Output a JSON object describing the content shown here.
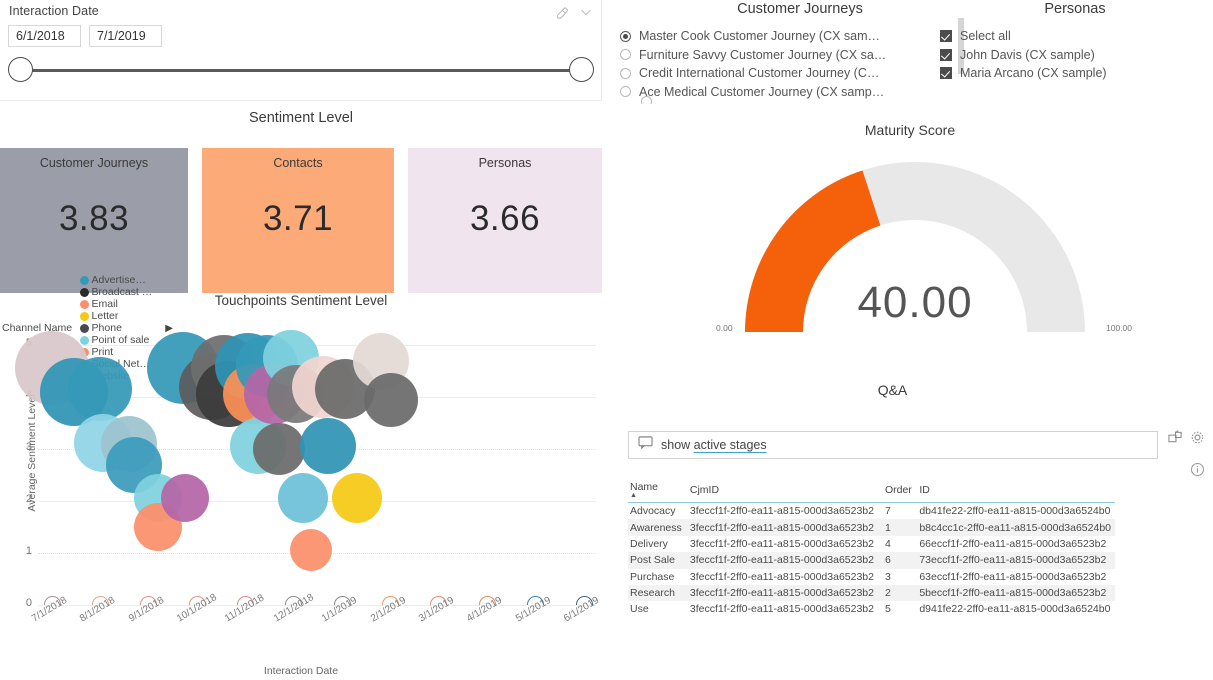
{
  "slicer": {
    "title": "Interaction Date",
    "start_date": "6/1/2018",
    "end_date": "7/1/2019",
    "eraser_icon": "eraser-icon",
    "chevron_icon": "chevron-down-icon"
  },
  "sentiment": {
    "title": "Sentiment  Level",
    "cards": [
      {
        "label": "Customer Journeys",
        "value": "3.83",
        "color": "#9b9da8"
      },
      {
        "label": "Contacts",
        "value": "3.71",
        "color": "#fcab78"
      },
      {
        "label": "Personas",
        "value": "3.66",
        "color": "#f0e4ef"
      }
    ]
  },
  "customer_journeys": {
    "title": "Customer Journeys",
    "items": [
      {
        "label": "Master Cook Customer Journey (CX sam…",
        "selected": true
      },
      {
        "label": "Furniture Savvy Customer Journey (CX sa…",
        "selected": false
      },
      {
        "label": "Credit International Customer Journey (C…",
        "selected": false
      },
      {
        "label": "Ace Medical Customer Journey (CX samp…",
        "selected": false
      }
    ]
  },
  "personas": {
    "title": "Personas",
    "items": [
      {
        "label": "Select all",
        "checked": true
      },
      {
        "label": "John Davis (CX sample)",
        "checked": true
      },
      {
        "label": "Maria Arcano (CX sample)",
        "checked": true
      }
    ]
  },
  "gauge": {
    "title": "Maturity Score",
    "value": "40.00",
    "min_label": "0.00",
    "max_label": "100.00",
    "fill_color": "#f4610a",
    "track_color": "#e8e8e8",
    "percent": 40
  },
  "qa": {
    "title": "Q&A",
    "prefix": "show ",
    "query_highlight": "active stages",
    "chat_icon": "chat-bubble-icon",
    "popout_icon": "pop-out-icon",
    "gear_icon": "gear-icon",
    "info_icon": "info-icon"
  },
  "table": {
    "columns": [
      "Name",
      "CjmID",
      "Order",
      "ID"
    ],
    "sorted_column": "Name",
    "rows": [
      [
        "Advocacy",
        "3feccf1f-2ff0-ea11-a815-000d3a6523b2",
        "7",
        "db41fe22-2ff0-ea11-a815-000d3a6524b0"
      ],
      [
        "Awareness",
        "3feccf1f-2ff0-ea11-a815-000d3a6523b2",
        "1",
        "b8c4cc1c-2ff0-ea11-a815-000d3a6524b0"
      ],
      [
        "Delivery",
        "3feccf1f-2ff0-ea11-a815-000d3a6523b2",
        "4",
        "66eccf1f-2ff0-ea11-a815-000d3a6523b2"
      ],
      [
        "Post Sale",
        "3feccf1f-2ff0-ea11-a815-000d3a6523b2",
        "6",
        "73eccf1f-2ff0-ea11-a815-000d3a6523b2"
      ],
      [
        "Purchase",
        "3feccf1f-2ff0-ea11-a815-000d3a6523b2",
        "3",
        "63eccf1f-2ff0-ea11-a815-000d3a6523b2"
      ],
      [
        "Research",
        "3feccf1f-2ff0-ea11-a815-000d3a6523b2",
        "2",
        "5beccf1f-2ff0-ea11-a815-000d3a6523b2"
      ],
      [
        "Use",
        "3feccf1f-2ff0-ea11-a815-000d3a6523b2",
        "5",
        "d941fe22-2ff0-ea11-a815-000d3a6524b0"
      ]
    ]
  },
  "chart_data": {
    "type": "scatter",
    "title": "Touchpoints Sentiment Level",
    "xlabel": "Interaction Date",
    "ylabel": "Average Sentiment Level",
    "ylim": [
      0,
      5
    ],
    "yticks": [
      0,
      1,
      2,
      3,
      4,
      5
    ],
    "grid": true,
    "legend_title": "Channel Name",
    "legend_position": "top",
    "legend": [
      {
        "name": "Advertise…",
        "color": "#3599b8"
      },
      {
        "name": "Broadcast …",
        "color": "#2b2b2b"
      },
      {
        "name": "Email",
        "color": "#fd8f6f"
      },
      {
        "name": "Letter",
        "color": "#f5c913"
      },
      {
        "name": "Phone",
        "color": "#4a4a4a"
      },
      {
        "name": "Point of sale",
        "color": "#7fd1de"
      },
      {
        "name": "Print",
        "color": "#f98f63"
      },
      {
        "name": "Social Net…",
        "color": "#b playing"
      },
      {
        "name": "Website",
        "color": "#2f94b5"
      }
    ],
    "xticks": [
      "7/1/2018",
      "8/1/2018",
      "9/1/2018",
      "10/1/2018",
      "11/1/2018",
      "12/1/2018",
      "1/1/2019",
      "2/1/2019",
      "3/1/2019",
      "4/1/2019",
      "5/1/2019",
      "6/1/2019"
    ],
    "points": [
      {
        "x": 0.0,
        "y": 4.55,
        "r": 37,
        "color": "#d8c7cb",
        "channel": "Print"
      },
      {
        "x": 0.45,
        "y": 4.1,
        "r": 34,
        "color": "#2f94b5",
        "channel": "Website"
      },
      {
        "x": 1.0,
        "y": 4.15,
        "r": 32,
        "color": "#3599b8",
        "channel": "Advertise…"
      },
      {
        "x": 1.05,
        "y": 3.12,
        "r": 29,
        "color": "#8fd4e6",
        "channel": "Point of sale"
      },
      {
        "x": 1.6,
        "y": 3.1,
        "r": 28,
        "color": "#9dc4cf",
        "channel": "Point of sale"
      },
      {
        "x": 1.7,
        "y": 2.7,
        "r": 28,
        "color": "#3b9cbb",
        "channel": "Website"
      },
      {
        "x": 2.2,
        "y": 2.05,
        "r": 24,
        "color": "#7fd1de",
        "channel": "Point of sale"
      },
      {
        "x": 2.2,
        "y": 1.5,
        "r": 24,
        "color": "#fb8f6b",
        "channel": "Email"
      },
      {
        "x": 2.75,
        "y": 2.05,
        "r": 24,
        "color": "#b565a7",
        "channel": "Social Net…"
      },
      {
        "x": 2.7,
        "y": 4.55,
        "r": 36,
        "color": "#3599b8",
        "channel": "Advertise…"
      },
      {
        "x": 3.3,
        "y": 4.2,
        "r": 33,
        "color": "#5c5c5c",
        "channel": "Phone"
      },
      {
        "x": 3.55,
        "y": 4.55,
        "r": 33,
        "color": "#6e6e6e",
        "channel": "Broadcast …"
      },
      {
        "x": 3.65,
        "y": 4.05,
        "r": 33,
        "color": "#3b3b3b",
        "channel": "Broadcast …"
      },
      {
        "x": 4.05,
        "y": 4.6,
        "r": 33,
        "color": "#2f94b5",
        "channel": "Website"
      },
      {
        "x": 4.15,
        "y": 4.05,
        "r": 30,
        "color": "#fb9056",
        "channel": "Email"
      },
      {
        "x": 4.25,
        "y": 3.05,
        "r": 28,
        "color": "#7fd1de",
        "channel": "Point of sale"
      },
      {
        "x": 4.45,
        "y": 4.6,
        "r": 31,
        "color": "#3599b8",
        "channel": "Advertise…"
      },
      {
        "x": 4.6,
        "y": 4.05,
        "r": 30,
        "color": "#b565a7",
        "channel": "Social Net…"
      },
      {
        "x": 4.7,
        "y": 3.0,
        "r": 26,
        "color": "#6b6b6b",
        "channel": "Phone"
      },
      {
        "x": 4.95,
        "y": 4.75,
        "r": 28,
        "color": "#7fd1de",
        "channel": "Point of sale"
      },
      {
        "x": 5.05,
        "y": 4.05,
        "r": 29,
        "color": "#7a7a7a",
        "channel": "Phone"
      },
      {
        "x": 5.2,
        "y": 2.05,
        "r": 25,
        "color": "#6dc1d8",
        "channel": "Point of sale"
      },
      {
        "x": 5.35,
        "y": 1.05,
        "r": 21,
        "color": "#fb8f6b",
        "channel": "Email"
      },
      {
        "x": 5.6,
        "y": 4.2,
        "r": 31,
        "color": "#f0d5d0",
        "channel": "Print"
      },
      {
        "x": 5.7,
        "y": 3.05,
        "r": 28,
        "color": "#2f94b5",
        "channel": "Website"
      },
      {
        "x": 6.05,
        "y": 4.15,
        "r": 30,
        "color": "#6b6b6b",
        "channel": "Phone"
      },
      {
        "x": 6.3,
        "y": 2.05,
        "r": 25,
        "color": "#f5c913",
        "channel": "Letter"
      },
      {
        "x": 6.8,
        "y": 4.7,
        "r": 28,
        "color": "#e3d8d4",
        "channel": "Print"
      },
      {
        "x": 7.0,
        "y": 3.95,
        "r": 27,
        "color": "#6b6b6b",
        "channel": "Phone"
      }
    ],
    "axis_markers": [
      {
        "x": 0,
        "color": "#a88a9c"
      },
      {
        "x": 1,
        "color": "#e8a08c"
      },
      {
        "x": 2,
        "color": "#e09080"
      },
      {
        "x": 3,
        "color": "#e09080"
      },
      {
        "x": 4,
        "color": "#d98f85"
      },
      {
        "x": 5,
        "color": "#8a8a8a"
      },
      {
        "x": 6,
        "color": "#8a8a8a"
      },
      {
        "x": 7,
        "color": "#ef9858"
      },
      {
        "x": 8,
        "color": "#e08b6a"
      },
      {
        "x": 9,
        "color": "#e08b6a"
      },
      {
        "x": 10,
        "color": "#3f7fa8"
      },
      {
        "x": 11,
        "color": "#3c5f86"
      }
    ]
  }
}
